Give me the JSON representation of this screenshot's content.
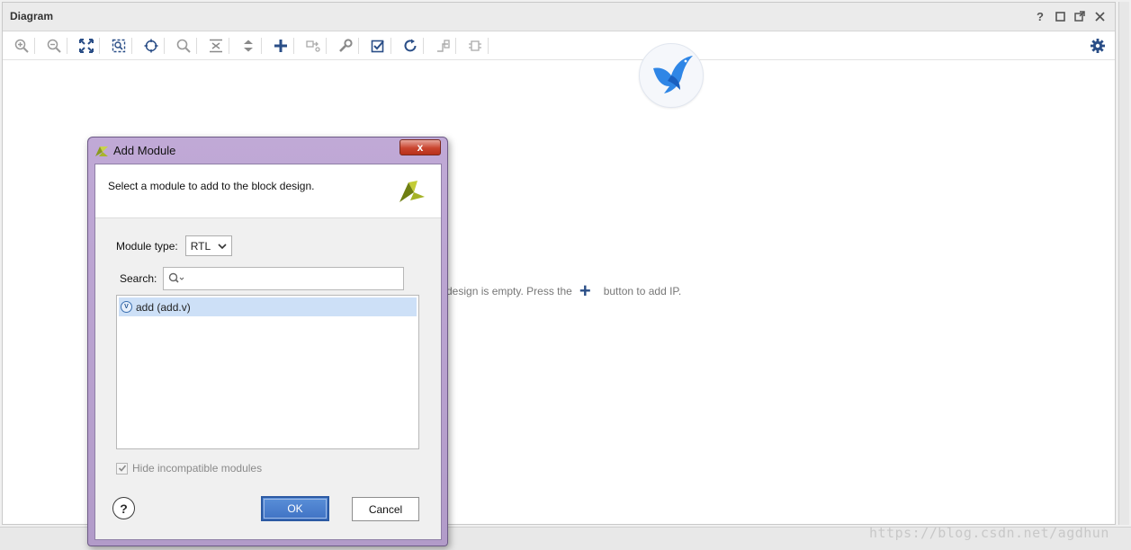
{
  "panel": {
    "title": "Diagram",
    "controls": [
      "help-icon",
      "maximize-icon",
      "float-icon",
      "close-icon"
    ],
    "toolbar": [
      "zoom-in-icon",
      "zoom-out-icon",
      "zoom-fit-icon",
      "zoom-area-icon",
      "center-icon",
      "search-icon",
      "collapse-icon",
      "expand-icon",
      "add-ip-icon",
      "add-port-icon",
      "properties-icon",
      "validate-icon",
      "regenerate-icon",
      "route-icon",
      "pin-icon",
      "settings-icon"
    ]
  },
  "canvas": {
    "empty_message_start": "design is empty. Press the",
    "empty_message_end": "button to add IP.",
    "plus_glyph": "+"
  },
  "watermark": "https://blog.csdn.net/agdhun",
  "dialog": {
    "title": "Add Module",
    "close_glyph": "x",
    "description": "Select a module to add to the block design.",
    "module_type_label": "Module type:",
    "module_type_value": "RTL",
    "search_label": "Search:",
    "search_value": "",
    "modules": [
      {
        "badge": "V",
        "label": "add (add.v)"
      }
    ],
    "hide_incompatible_label": "Hide incompatible modules",
    "hide_incompatible_checked": true,
    "help_glyph": "?",
    "ok_label": "OK",
    "cancel_label": "Cancel"
  },
  "colors": {
    "dialog_frame": "#b29bc9",
    "ok_button": "#3f72c4",
    "selected_row": "#cde0f7",
    "toolbar_icon": "#2a4e87"
  }
}
